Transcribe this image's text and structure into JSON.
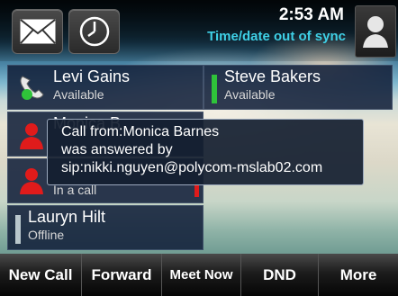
{
  "status_bar": {
    "time": "2:53 AM",
    "sync_message": "Time/date out of sync"
  },
  "contacts": [
    {
      "name": "Levi Gains",
      "status": "Available",
      "icon": "phone-handset-icon"
    },
    {
      "name": "Steve Bakers",
      "status": "Available",
      "indicator_color": "#2fc33a"
    },
    {
      "name": "Monica B",
      "status": "",
      "icon": "person-icon"
    },
    {
      "name": "",
      "status": "In a call",
      "icon": "person-icon",
      "indicator_color": "#e01b1b"
    },
    {
      "name": "Lauryn Hilt",
      "status": "Offline",
      "indicator_color": "#b9c7cc"
    }
  ],
  "notification": {
    "line1": "Call from:Monica Barnes",
    "line2": "was answered by",
    "line3": "sip:nikki.nguyen@polycom-mslab02.com"
  },
  "softkeys": [
    "New Call",
    "Forward",
    "Meet Now",
    "DND",
    "More"
  ],
  "colors": {
    "accent_text": "#3fd0e6",
    "tile_bg": "#12203a",
    "available": "#2fc33a",
    "busy": "#e01b1b",
    "offline": "#b9c7cc"
  }
}
